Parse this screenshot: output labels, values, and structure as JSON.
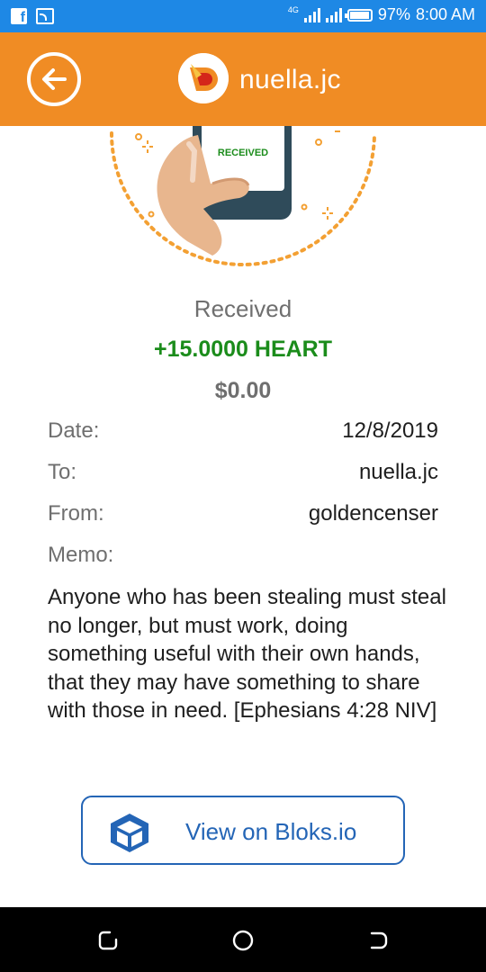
{
  "status_bar": {
    "network": "4G",
    "battery": "97%",
    "battery_level": 0.97,
    "time": "8:00 AM",
    "icons": [
      "facebook-icon",
      "cast-icon",
      "signal-icon",
      "signal-icon",
      "battery-icon"
    ]
  },
  "header": {
    "back_icon": "arrow-left-icon",
    "title": "nuella.jc",
    "accent": "#f08c24"
  },
  "hero": {
    "phone_label": "RECEIVED"
  },
  "transaction": {
    "status": "Received",
    "amount": "+15.0000 HEART",
    "usd_value": "$0.00",
    "amount_color": "#1b8c1b"
  },
  "details": {
    "date_label": "Date:",
    "date_value": "12/8/2019",
    "to_label": "To:",
    "to_value": "nuella.jc",
    "from_label": "From:",
    "from_value": "goldencenser",
    "memo_label": "Memo:",
    "memo_text": "Anyone who has been stealing must steal no longer, but must work, doing something useful with their own hands, that they may have something to share with those in need. [Ephesians 4:28 NIV]"
  },
  "actions": {
    "view_button_label": "View on Bloks.io",
    "view_button_icon": "cube-icon",
    "brand_blue": "#2465b6"
  },
  "nav_bar": {
    "icons": [
      "recent-apps-icon",
      "home-icon",
      "back-icon"
    ]
  }
}
